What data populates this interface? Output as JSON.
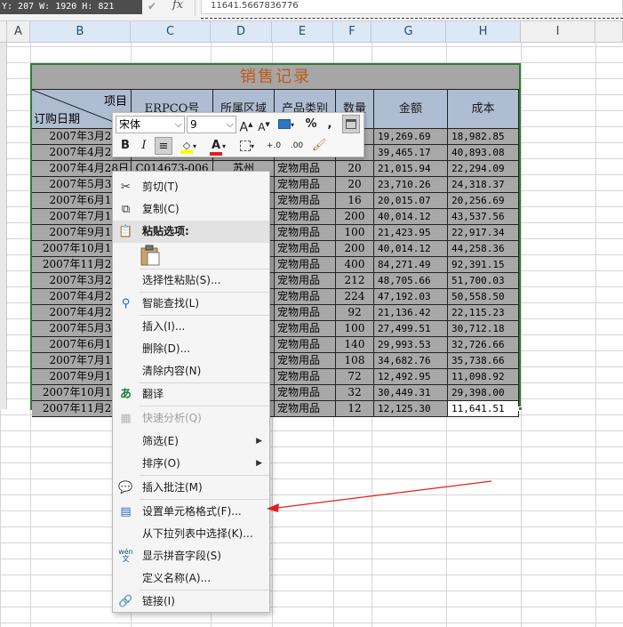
{
  "status": {
    "namebox": "Y: 207 W: 1920 H: 821",
    "fx_symbol": "fx",
    "formula_value": "11641.5667836776"
  },
  "columns": [
    "A",
    "B",
    "C",
    "D",
    "E",
    "F",
    "G",
    "H",
    "I"
  ],
  "table": {
    "title": "销售记录",
    "header_item": "项目",
    "header_date": "订购日期",
    "headers": [
      "ERPCO号",
      "所属区域",
      "产品类别",
      "数量",
      "金额",
      "成本"
    ],
    "rows": [
      {
        "date": "2007年3月21日",
        "code": "",
        "area": "",
        "cat": "",
        "qty": "",
        "amt": "19,269.69",
        "cost": "18,982.85"
      },
      {
        "date": "2007年4月28日",
        "code": "",
        "area": "",
        "cat": "",
        "qty": "",
        "amt": "39,465.17",
        "cost": "40,893.08"
      },
      {
        "date": "2007年4月28日",
        "code": "C014673-006",
        "area": "苏州",
        "cat": "宠物用品",
        "qty": "20",
        "amt": "21,015.94",
        "cost": "22,294.09"
      },
      {
        "date": "2007年5月31日",
        "code": "",
        "area": "",
        "cat": "宠物用品",
        "qty": "20",
        "amt": "23,710.26",
        "cost": "24,318.37"
      },
      {
        "date": "2007年6月13日",
        "code": "",
        "area": "",
        "cat": "宠物用品",
        "qty": "16",
        "amt": "20,015.07",
        "cost": "20,256.69"
      },
      {
        "date": "2007年7月16日",
        "code": "",
        "area": "",
        "cat": "宠物用品",
        "qty": "200",
        "amt": "40,014.12",
        "cost": "43,537.56"
      },
      {
        "date": "2007年9月14日",
        "code": "",
        "area": "",
        "cat": "宠物用品",
        "qty": "100",
        "amt": "21,423.95",
        "cost": "22,917.34"
      },
      {
        "date": "2007年10月19日",
        "code": "",
        "area": "",
        "cat": "宠物用品",
        "qty": "200",
        "amt": "40,014.12",
        "cost": "44,258.36"
      },
      {
        "date": "2007年11月20日",
        "code": "",
        "area": "",
        "cat": "宠物用品",
        "qty": "400",
        "amt": "84,271.49",
        "cost": "92,391.15"
      },
      {
        "date": "2007年3月21日",
        "code": "",
        "area": "",
        "cat": "宠物用品",
        "qty": "212",
        "amt": "48,705.66",
        "cost": "51,700.03"
      },
      {
        "date": "2007年4月28日",
        "code": "",
        "area": "",
        "cat": "宠物用品",
        "qty": "224",
        "amt": "47,192.03",
        "cost": "50,558.50"
      },
      {
        "date": "2007年4月28日",
        "code": "",
        "area": "",
        "cat": "宠物用品",
        "qty": "92",
        "amt": "21,136.42",
        "cost": "22,115.23"
      },
      {
        "date": "2007年5月31日",
        "code": "",
        "area": "",
        "cat": "宠物用品",
        "qty": "100",
        "amt": "27,499.51",
        "cost": "30,712.18"
      },
      {
        "date": "2007年6月13日",
        "code": "",
        "area": "",
        "cat": "宠物用品",
        "qty": "140",
        "amt": "29,993.53",
        "cost": "32,726.66"
      },
      {
        "date": "2007年7月16日",
        "code": "",
        "area": "",
        "cat": "宠物用品",
        "qty": "108",
        "amt": "34,682.76",
        "cost": "35,738.66"
      },
      {
        "date": "2007年9月14日",
        "code": "",
        "area": "",
        "cat": "宠物用品",
        "qty": "72",
        "amt": "12,492.95",
        "cost": "11,098.92"
      },
      {
        "date": "2007年10月19日",
        "code": "",
        "area": "",
        "cat": "宠物用品",
        "qty": "32",
        "amt": "30,449.31",
        "cost": "29,398.00"
      },
      {
        "date": "2007年11月20日",
        "code": "",
        "area": "",
        "cat": "宠物用品",
        "qty": "12",
        "amt": "12,125.30",
        "cost": "11,641.51"
      }
    ]
  },
  "mini_toolbar": {
    "font_name": "宋体",
    "font_size": "9",
    "bold": "B",
    "italic": "I",
    "percent": "%",
    "comma": ",",
    "grow_font": "A",
    "shrink_font": "A",
    "font_color": "A",
    "inc_decimal": "+.0",
    "dec_decimal": ".00"
  },
  "context_menu": {
    "items": [
      {
        "label": "剪切(T)",
        "icon": "scissors-icon",
        "disabled": false
      },
      {
        "label": "复制(C)",
        "icon": "copy-icon",
        "disabled": false
      },
      {
        "label": "粘贴选项:",
        "icon": "paste-icon",
        "disabled": false
      },
      {
        "label": "选择性粘贴(S)...",
        "icon": "",
        "disabled": false
      },
      {
        "label": "智能查找(L)",
        "icon": "smart-lookup-icon",
        "disabled": false
      },
      {
        "label": "插入(I)...",
        "icon": "",
        "disabled": false
      },
      {
        "label": "删除(D)...",
        "icon": "",
        "disabled": false
      },
      {
        "label": "清除内容(N)",
        "icon": "",
        "disabled": false
      },
      {
        "label": "翻译",
        "icon": "translate-icon",
        "disabled": false
      },
      {
        "label": "快速分析(Q)",
        "icon": "quick-analysis-icon",
        "disabled": true
      },
      {
        "label": "筛选(E)",
        "icon": "",
        "disabled": false
      },
      {
        "label": "排序(O)",
        "icon": "",
        "disabled": false
      },
      {
        "label": "插入批注(M)",
        "icon": "comment-icon",
        "disabled": false
      },
      {
        "label": "设置单元格格式(F)...",
        "icon": "format-cells-icon",
        "disabled": false
      },
      {
        "label": "从下拉列表中选择(K)...",
        "icon": "",
        "disabled": false
      },
      {
        "label": "显示拼音字段(S)",
        "icon": "phonetic-icon",
        "disabled": false
      },
      {
        "label": "定义名称(A)...",
        "icon": "",
        "disabled": false
      },
      {
        "label": "链接(I)",
        "icon": "link-icon",
        "disabled": false
      }
    ],
    "phonetic_glyph": "wén\n文"
  },
  "colors": {
    "title_text": "#c05a1a",
    "header_fill": "#aebdd2",
    "body_fill": "#a8a8a8",
    "selection_border": "#2e7d32",
    "annotation_arrow": "#e0201b"
  }
}
